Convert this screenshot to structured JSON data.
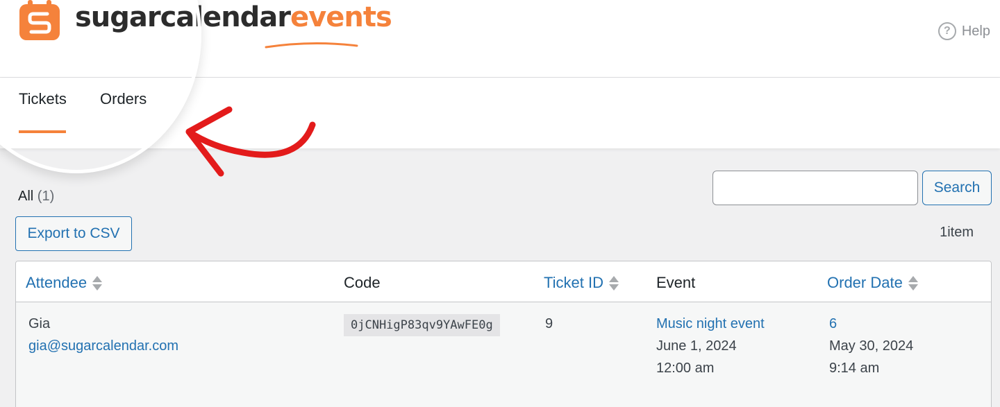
{
  "brand": {
    "name_part1": "sugarcale",
    "name_part2": "ndar",
    "name_part3": "events",
    "accent_color": "#f5823b",
    "icon": "calendar-s-icon"
  },
  "header": {
    "help_label": "Help",
    "help_icon": "question-circle-icon"
  },
  "tabs": [
    {
      "label": "Tickets",
      "active": true
    },
    {
      "label": "Orders",
      "active": false
    }
  ],
  "filters": {
    "all_label": "All",
    "all_count": "(1)"
  },
  "toolbar": {
    "export_label": "Export to CSV",
    "search_placeholder": "",
    "search_label": "Search",
    "item_count": "1item"
  },
  "table": {
    "columns": [
      {
        "label": "Attendee",
        "sortable": true
      },
      {
        "label": "Code",
        "sortable": false
      },
      {
        "label": "Ticket ID",
        "sortable": true
      },
      {
        "label": "Event",
        "sortable": false
      },
      {
        "label": "Order Date",
        "sortable": true
      }
    ],
    "rows": [
      {
        "attendee_name": "Gia",
        "attendee_email": "gia@sugarcalendar.com",
        "code": "0jCNHigP83qv9YAwFE0g",
        "ticket_id": "9",
        "event_name": "Music night event",
        "event_date": "June 1, 2024",
        "event_time": "12:00 am",
        "order_id": "6",
        "order_date": "May 30, 2024",
        "order_time": "9:14 am"
      }
    ]
  },
  "annotation": {
    "arrow_color": "#e31b1b"
  }
}
